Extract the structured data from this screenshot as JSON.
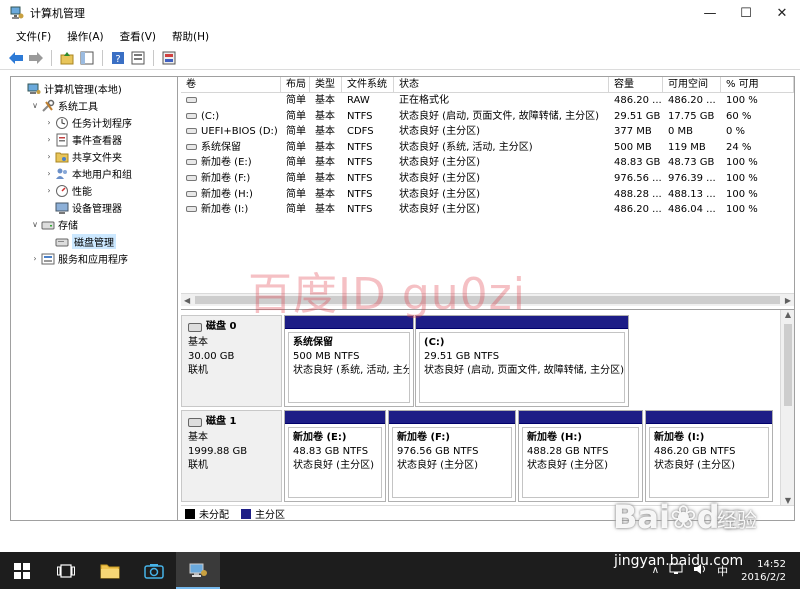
{
  "window": {
    "title": "计算机管理",
    "minimize": "—",
    "maximize": "☐",
    "close": "✕"
  },
  "menu": [
    "文件(F)",
    "操作(A)",
    "查看(V)",
    "帮助(H)"
  ],
  "tree": [
    {
      "label": "计算机管理(本地)",
      "indent": 0,
      "toggle": "",
      "icon": "computer-icon"
    },
    {
      "label": "系统工具",
      "indent": 1,
      "toggle": "∨",
      "icon": "tools-icon"
    },
    {
      "label": "任务计划程序",
      "indent": 2,
      "toggle": "›",
      "icon": "clock-icon"
    },
    {
      "label": "事件查看器",
      "indent": 2,
      "toggle": "›",
      "icon": "event-log-icon"
    },
    {
      "label": "共享文件夹",
      "indent": 2,
      "toggle": "›",
      "icon": "shared-folder-icon"
    },
    {
      "label": "本地用户和组",
      "indent": 2,
      "toggle": "›",
      "icon": "users-icon"
    },
    {
      "label": "性能",
      "indent": 2,
      "toggle": "›",
      "icon": "performance-icon"
    },
    {
      "label": "设备管理器",
      "indent": 2,
      "toggle": "",
      "icon": "device-manager-icon"
    },
    {
      "label": "存储",
      "indent": 1,
      "toggle": "∨",
      "icon": "storage-icon"
    },
    {
      "label": "磁盘管理",
      "indent": 2,
      "toggle": "",
      "icon": "disk-management-icon",
      "selected": true
    },
    {
      "label": "服务和应用程序",
      "indent": 1,
      "toggle": "›",
      "icon": "services-icon"
    }
  ],
  "volumes": {
    "headers": [
      "卷",
      "布局",
      "类型",
      "文件系统",
      "状态",
      "容量",
      "可用空间",
      "% 可用"
    ],
    "rows": [
      [
        "",
        "简单",
        "基本",
        "RAW",
        "正在格式化",
        "486.20 ...",
        "486.20 ...",
        "100 %"
      ],
      [
        "(C:)",
        "简单",
        "基本",
        "NTFS",
        "状态良好 (启动, 页面文件, 故障转储, 主分区)",
        "29.51 GB",
        "17.75 GB",
        "60 %"
      ],
      [
        "UEFI+BIOS (D:)",
        "简单",
        "基本",
        "CDFS",
        "状态良好 (主分区)",
        "377 MB",
        "0 MB",
        "0 %"
      ],
      [
        "系统保留",
        "简单",
        "基本",
        "NTFS",
        "状态良好 (系统, 活动, 主分区)",
        "500 MB",
        "119 MB",
        "24 %"
      ],
      [
        "新加卷 (E:)",
        "简单",
        "基本",
        "NTFS",
        "状态良好 (主分区)",
        "48.83 GB",
        "48.73 GB",
        "100 %"
      ],
      [
        "新加卷 (F:)",
        "简单",
        "基本",
        "NTFS",
        "状态良好 (主分区)",
        "976.56 ...",
        "976.39 ...",
        "100 %"
      ],
      [
        "新加卷 (H:)",
        "简单",
        "基本",
        "NTFS",
        "状态良好 (主分区)",
        "488.28 ...",
        "488.13 ...",
        "100 %"
      ],
      [
        "新加卷 (I:)",
        "简单",
        "基本",
        "NTFS",
        "状态良好 (主分区)",
        "486.20 ...",
        "486.04 ...",
        "100 %"
      ]
    ]
  },
  "disks": [
    {
      "name": "磁盘 0",
      "type": "基本",
      "size": "30.00 GB",
      "status": "联机",
      "partitions": [
        {
          "name": "系统保留",
          "size": "500 MB NTFS",
          "status": "状态良好 (系统, 活动, 主分区)"
        },
        {
          "name": "(C:)",
          "size": "29.51 GB NTFS",
          "status": "状态良好 (启动, 页面文件, 故障转储, 主分区)"
        }
      ]
    },
    {
      "name": "磁盘 1",
      "type": "基本",
      "size": "1999.88 GB",
      "status": "联机",
      "partitions": [
        {
          "name": "新加卷 (E:)",
          "size": "48.83 GB NTFS",
          "status": "状态良好 (主分区)"
        },
        {
          "name": "新加卷 (F:)",
          "size": "976.56 GB NTFS",
          "status": "状态良好 (主分区)"
        },
        {
          "name": "新加卷 (H:)",
          "size": "488.28 GB NTFS",
          "status": "状态良好 (主分区)"
        },
        {
          "name": "新加卷 (I:)",
          "size": "486.20 GB NTFS",
          "status": "状态良好 (主分区)"
        }
      ]
    }
  ],
  "legend": [
    {
      "label": "未分配",
      "color": "#000000"
    },
    {
      "label": "主分区",
      "color": "#1d1d86"
    }
  ],
  "watermark": "百度ID gu0zi",
  "baidu": {
    "logo": "Bai",
    "logo_paw": "du",
    "logo_sub": "经验",
    "url": "jingyan.baidu.com"
  },
  "taskbar": {
    "ime": "中",
    "time": "14:52",
    "date": "2016/2/2"
  },
  "colors": {
    "primary_partition": "#1d1d86",
    "selection": "#cce8ff",
    "accent": "#76b9ed"
  }
}
